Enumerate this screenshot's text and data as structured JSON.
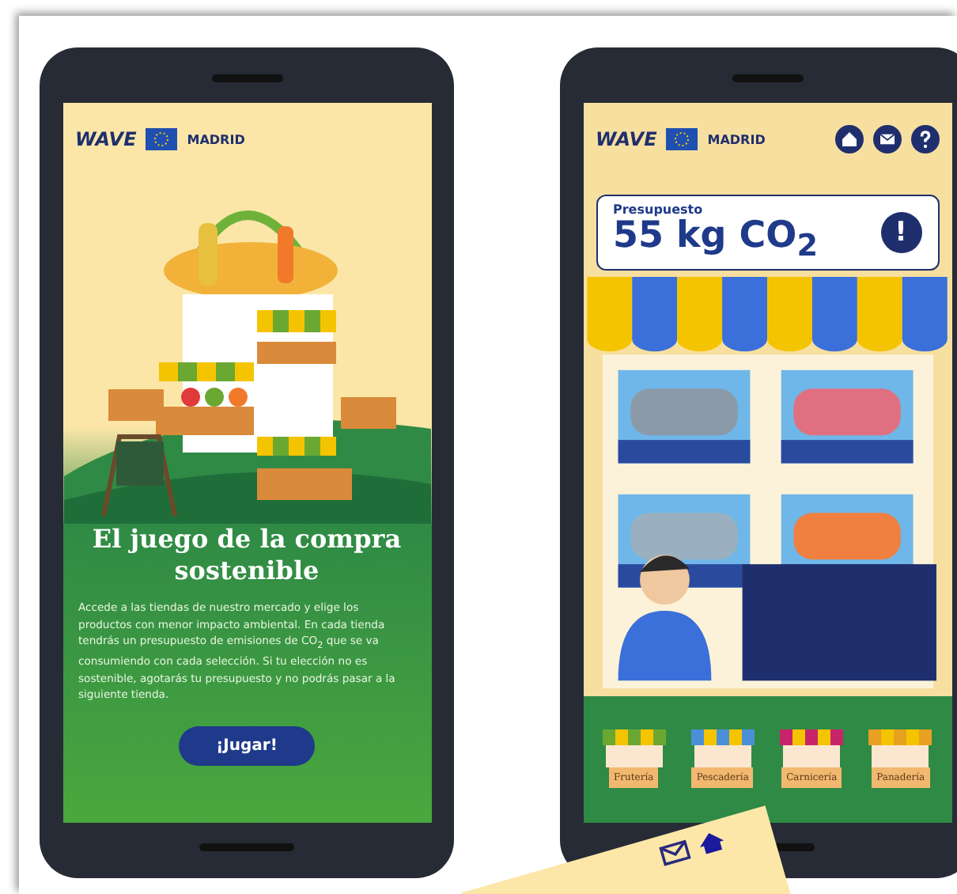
{
  "intro_screen": {
    "logos": {
      "project": "WAVE",
      "city": "MADRID"
    },
    "title": "El juego de la compra sostenible",
    "description": "Accede a las tiendas de nuestro mercado y elige los productos con menor impacto ambiental. En cada tienda tendrás un presupuesto de emisiones de CO$_{2}$ que se va consumiendo con cada selección. Si tu elección no es sostenible, agotarás tu presupuesto y no podrás pasar a la siguiente tienda.",
    "button": "¡Jugar!"
  },
  "game_screen": {
    "logos": {
      "project": "WAVE",
      "city": "MADRID"
    },
    "budget": {
      "label": "Presupuesto",
      "value": "55 kg CO$_{2}$",
      "alert": "!"
    },
    "shops": [
      {
        "name": "Frutería",
        "color": "#6aa832"
      },
      {
        "name": "Pescadería",
        "color": "#4a90d9"
      },
      {
        "name": "Carnicería",
        "color": "#c8246a"
      },
      {
        "name": "Panadería",
        "color": "#e8a020"
      }
    ]
  }
}
